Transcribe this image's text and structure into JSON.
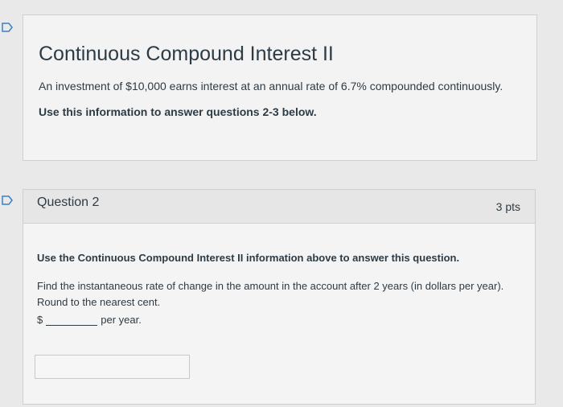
{
  "intro": {
    "title": "Continuous Compound Interest II",
    "text": "An investment of $10,000 earns interest at an annual rate of 6.7% compounded continuously.",
    "instruction": "Use this information to answer questions 2-3 below."
  },
  "question": {
    "title": "Question 2",
    "points": "3 pts",
    "line1": "Use the Continuous Compound Interest II information above to answer this question.",
    "line2": "Find the instantaneous rate of change in the amount in the account after 2 years (in dollars per year). Round to the nearest cent.",
    "currency": "$",
    "unit": "per year.",
    "answer_value": ""
  },
  "icons": {
    "intro_flag": "flag-outline-icon",
    "question_flag": "flag-outline-icon"
  }
}
